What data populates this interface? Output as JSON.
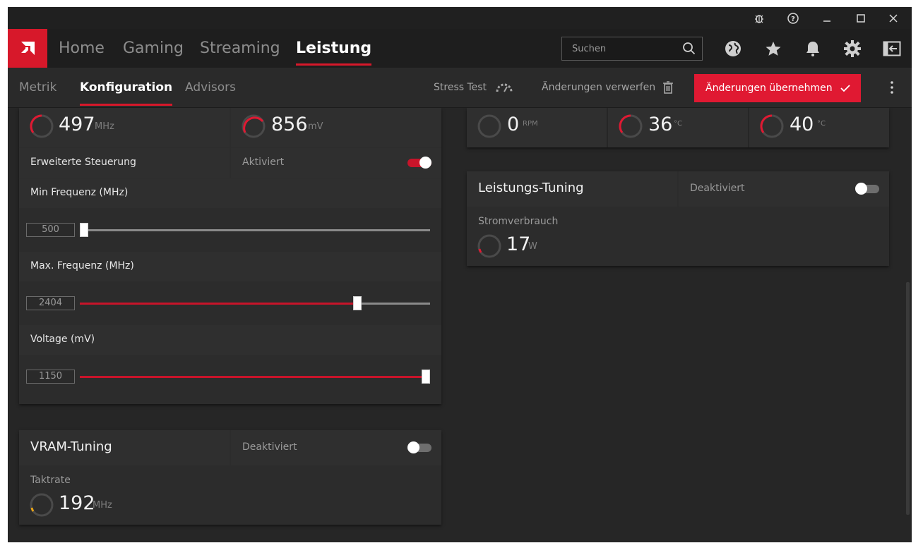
{
  "titlebar": {
    "icons": [
      "bug-icon",
      "help-icon",
      "minimize-icon",
      "maximize-icon",
      "close-icon"
    ]
  },
  "nav": {
    "tabs": [
      "Home",
      "Gaming",
      "Streaming",
      "Leistung"
    ],
    "active": "Leistung",
    "search_placeholder": "Suchen",
    "icons": [
      "globe-icon",
      "star-icon",
      "bell-icon",
      "gear-icon",
      "collapse-panel-icon"
    ]
  },
  "subnav": {
    "tabs": [
      "Metrik",
      "Konfiguration",
      "Advisors"
    ],
    "active": "Konfiguration",
    "stress_test": "Stress Test",
    "discard": "Änderungen verwerfen",
    "apply": "Änderungen übernehmen"
  },
  "gpu": {
    "clock": {
      "value": "497",
      "unit": "MHz"
    },
    "voltage": {
      "value": "856",
      "unit": "mV"
    },
    "advanced_label": "Erweiterte Steuerung",
    "advanced_state": "Aktiviert",
    "advanced_on": true,
    "min_freq": {
      "label": "Min Frequenz (MHz)",
      "value": "500",
      "fraction": 0.0
    },
    "max_freq": {
      "label": "Max. Frequenz (MHz)",
      "value": "2404",
      "fraction": 0.8
    },
    "voltage_slider": {
      "label": "Voltage (mV)",
      "value": "1150",
      "fraction": 1.0
    }
  },
  "vram": {
    "title": "VRAM-Tuning",
    "state": "Deaktiviert",
    "rate_label": "Taktrate",
    "rate": {
      "value": "192",
      "unit": "MHz"
    }
  },
  "fan": {
    "rpm": {
      "value": "0",
      "unit": "RPM"
    },
    "temp1": {
      "value": "36",
      "unit": "°C"
    },
    "temp2": {
      "value": "40",
      "unit": "°C"
    }
  },
  "power": {
    "title": "Leistungs-Tuning",
    "state": "Deaktiviert",
    "usage_label": "Stromverbrauch",
    "usage": {
      "value": "17",
      "unit": "W"
    }
  },
  "colors": {
    "accent": "#e01932",
    "bg": "#262626",
    "card": "#2c2c2c"
  }
}
